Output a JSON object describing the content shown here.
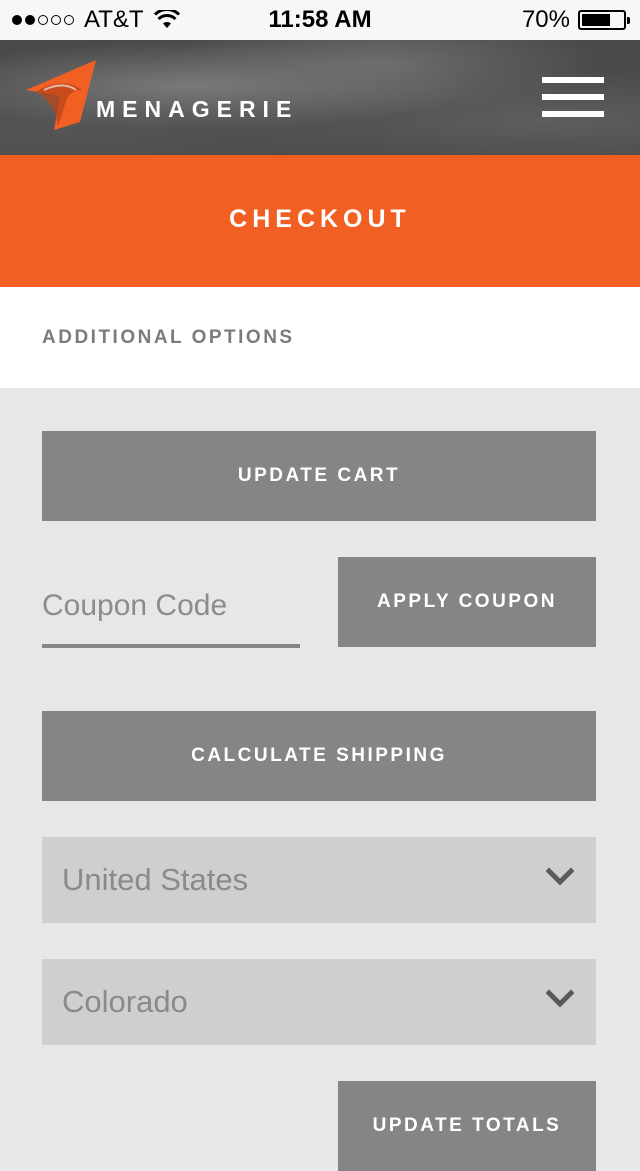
{
  "status_bar": {
    "carrier": "AT&T",
    "time": "11:58 AM",
    "battery_percent": "70%",
    "battery_level": 0.7,
    "signal_bars_filled": 2,
    "signal_bars_total": 5
  },
  "header": {
    "brand": "MENAGERIE",
    "logo_icon": "menagerie-logo-icon",
    "menu_icon": "hamburger-menu-icon",
    "accent_color": "#f15f22"
  },
  "banner": {
    "title": "CHECKOUT"
  },
  "options": {
    "title": "ADDITIONAL OPTIONS"
  },
  "actions": {
    "update_cart_label": "UPDATE CART",
    "coupon_placeholder": "Coupon Code",
    "apply_coupon_label": "APPLY COUPON",
    "calculate_shipping_label": "CALCULATE SHIPPING",
    "update_totals_label": "UPDATE TOTALS"
  },
  "shipping": {
    "country": "United States",
    "state": "Colorado"
  }
}
